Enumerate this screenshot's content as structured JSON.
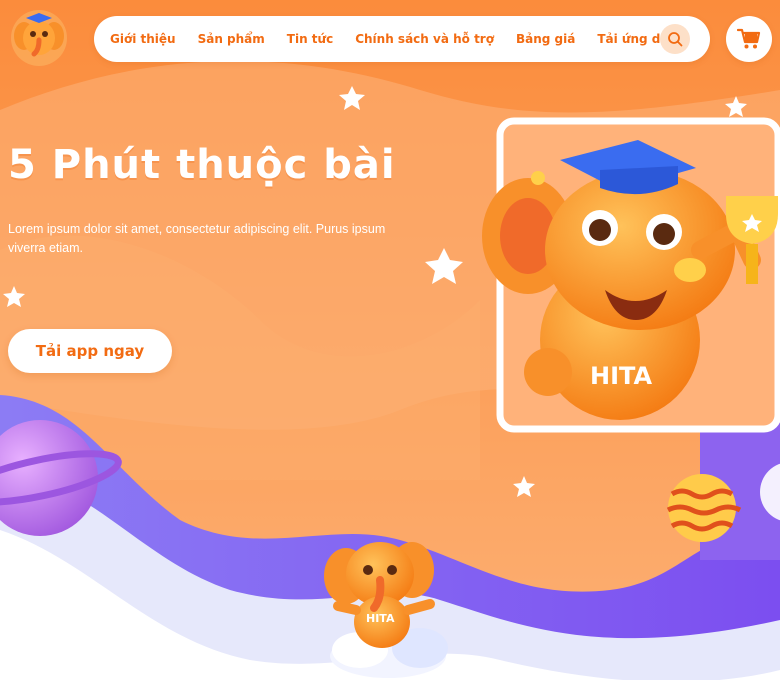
{
  "brand": {
    "logo_icon": "elephant-mascot-logo",
    "mascot_name": "HITA"
  },
  "nav": {
    "items": [
      {
        "label": "Giới thiệu"
      },
      {
        "label": "Sản phẩm"
      },
      {
        "label": "Tin tức"
      },
      {
        "label": "Chính sách và hỗ trợ"
      },
      {
        "label": "Bảng giá"
      },
      {
        "label": "Tải ứng dụng"
      }
    ],
    "search_icon": "search-icon",
    "cart_icon": "cart-icon"
  },
  "hero": {
    "title": "5 Phút thuộc bài",
    "description": "Lorem ipsum dolor sit amet, consectetur adipiscing elit. Purus ipsum viverra etiam.",
    "cta_label": "Tải app ngay"
  },
  "colors": {
    "accent": "#f26b12",
    "background": "#fb9a4f",
    "purple": "#8a5cf0",
    "white": "#ffffff"
  }
}
